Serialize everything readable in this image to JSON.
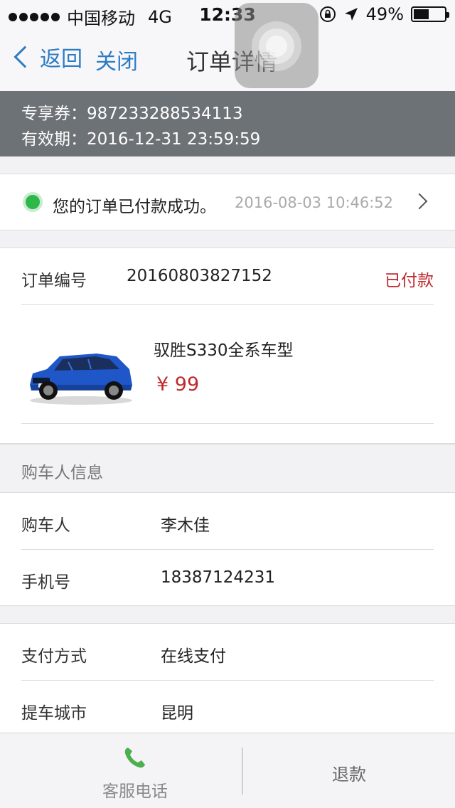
{
  "status_bar": {
    "carrier": "中国移动",
    "network": "4G",
    "time": "12:33",
    "battery": "49%",
    "battery_level": 0.49
  },
  "nav": {
    "back_label": "返回",
    "close_label": "关闭",
    "title": "订单详情"
  },
  "coupon": {
    "code_label": "专享券：",
    "code_value": "987233288534113",
    "expiry_label": "有效期：",
    "expiry_value": "2016-12-31 23:59:59"
  },
  "order_status": {
    "message": "您的订单已付款成功。",
    "timestamp": "2016-08-03 10:46:52",
    "status_color": "#2eb84a"
  },
  "order": {
    "number_label": "订单编号",
    "number_value": "20160803827152",
    "paid_label": "已付款",
    "product_name": "驭胜S330全系车型",
    "price": "¥ 99",
    "price_color": "#c0282d"
  },
  "buyer": {
    "section_title": "购车人信息",
    "name_label": "购车人",
    "name_value": "李木佳",
    "phone_label": "手机号",
    "phone_value": "18387124231"
  },
  "payment": {
    "method_label": "支付方式",
    "method_value": "在线支付",
    "city_label": "提车城市",
    "city_value": "昆明"
  },
  "bottom": {
    "service_label": "客服电话",
    "refund_label": "退款"
  },
  "colors": {
    "link": "#2d7cc3",
    "header_band": "#6d7277",
    "phone_icon": "#4caf50"
  }
}
